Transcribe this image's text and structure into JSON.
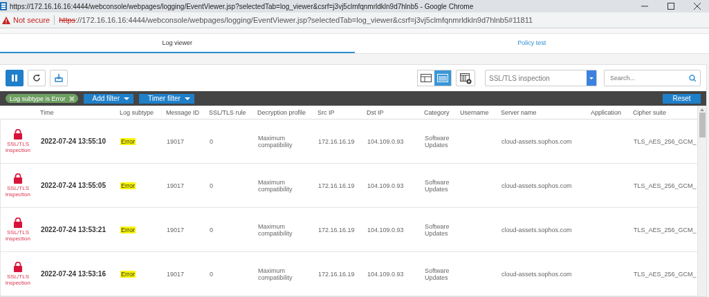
{
  "window": {
    "title": "https://172.16.16.16:4444/webconsole/webpages/logging/EventViewer.jsp?selectedTab=log_viewer&csrf=j3vj5clmfqnmrldkln9d7hlnb5 - Google Chrome"
  },
  "address_bar": {
    "security": "Not secure",
    "scheme": "https",
    "url": "://172.16.16.16:4444/webconsole/webpages/logging/EventViewer.jsp?selectedTab=log_viewer&csrf=j3vj5clmfqnmrldkln9d7hlnb5#11811"
  },
  "tabs": [
    {
      "label": "Log viewer",
      "selected": true
    },
    {
      "label": "Policy test",
      "selected": false
    }
  ],
  "toolbar": {
    "buttons": [
      {
        "kind": "pause",
        "on": true
      },
      {
        "kind": "refresh",
        "on": false
      },
      {
        "kind": "export",
        "on": false
      }
    ],
    "views": [
      {
        "kind": "panes",
        "selected": false
      },
      {
        "kind": "columns",
        "selected": true
      }
    ],
    "log_source": "SSL/TLS inspection",
    "search": {
      "placeholder": "Search..."
    }
  },
  "filter_bar": {
    "chips": [
      "Log subtype is Error"
    ],
    "buttons": [
      "Add filter",
      "Timer filter"
    ],
    "reset": "Reset"
  },
  "table": {
    "columns": [
      "Time",
      "Log subtype",
      "Message ID",
      "SSL/TLS rule",
      "Decryption profile",
      "Src IP",
      "Dst IP",
      "Category",
      "Username",
      "Server name",
      "Application",
      "Cipher suite"
    ],
    "rows": [
      {
        "module": "SSL/TLS inspection",
        "time": "2022-07-24 13:55:10",
        "log_subtype": "Error",
        "message_id": "19017",
        "rule": "0",
        "profile": "Maximum compatibility",
        "src_ip": "172.16.16.19",
        "dst_ip": "104.109.0.93",
        "category": "Software Updates",
        "server": "cloud-assets.sophos.com",
        "cipher": "TLS_AES_256_GCM_"
      },
      {
        "module": "SSL/TLS inspection",
        "time": "2022-07-24 13:55:05",
        "log_subtype": "Error",
        "message_id": "19017",
        "rule": "0",
        "profile": "Maximum compatibility",
        "src_ip": "172.16.16.19",
        "dst_ip": "104.109.0.93",
        "category": "Software Updates",
        "server": "cloud-assets.sophos.com",
        "cipher": "TLS_AES_256_GCM_"
      },
      {
        "module": "SSL/TLS inspection",
        "time": "2022-07-24 13:53:21",
        "log_subtype": "Error",
        "message_id": "19017",
        "rule": "0",
        "profile": "Maximum compatibility",
        "src_ip": "172.16.16.19",
        "dst_ip": "104.109.0.93",
        "category": "Software Updates",
        "server": "cloud-assets.sophos.com",
        "cipher": "TLS_AES_256_GCM_"
      },
      {
        "module": "SSL/TLS inspection",
        "time": "2022-07-24 13:53:16",
        "log_subtype": "Error",
        "message_id": "19017",
        "rule": "0",
        "profile": "Maximum compatibility",
        "src_ip": "172.16.16.19",
        "dst_ip": "104.109.0.93",
        "category": "Software Updates",
        "server": "cloud-assets.sophos.com",
        "cipher": "TLS_AES_256_GCM_"
      }
    ]
  }
}
